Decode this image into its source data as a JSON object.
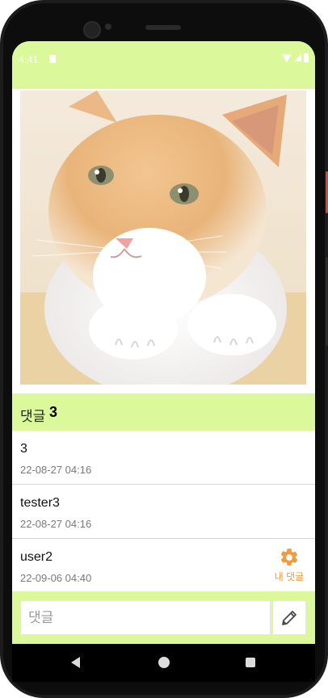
{
  "status_bar": {
    "time": "4:41"
  },
  "comments_header": {
    "label": "댓글",
    "count": "3"
  },
  "comments": [
    {
      "content": "3",
      "date": "22-08-27 04:16"
    },
    {
      "content": "tester3",
      "date": "22-08-27 04:16"
    },
    {
      "content": "user2",
      "date": "22-09-06 04:40",
      "mine_label": "내 댓글"
    }
  ],
  "comment_input": {
    "placeholder": "댓글",
    "value": ""
  },
  "colors": {
    "accent_bg": "#dbf99a",
    "mine_orange": "#f39a3b"
  },
  "icons": {
    "settings": "gear-icon",
    "send": "pencil-icon"
  }
}
